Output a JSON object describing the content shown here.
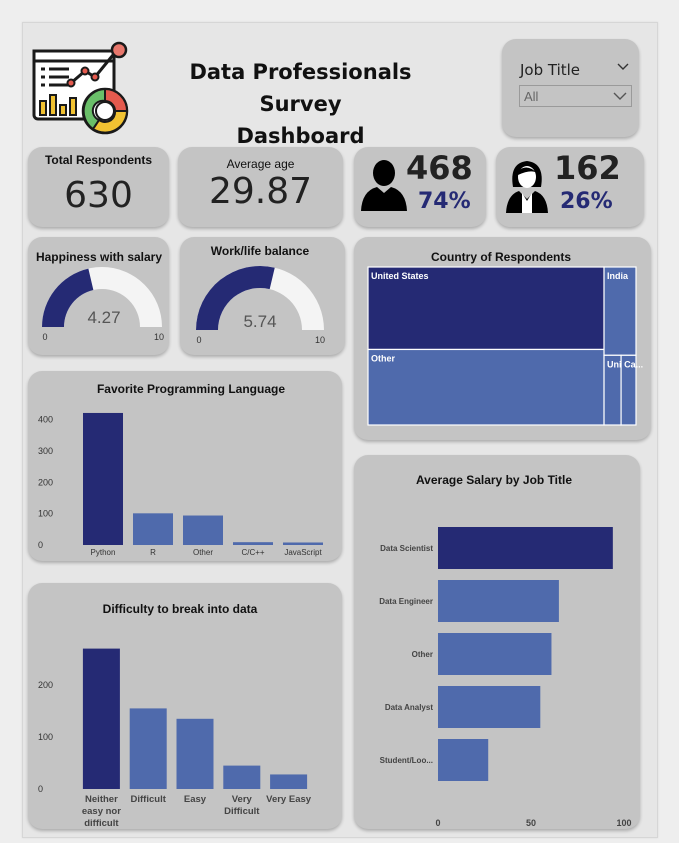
{
  "header": {
    "title_line1": "Data Professionals Survey",
    "title_line2": "Dashboard",
    "logo_icon": "analytics-dashboard-icon"
  },
  "filter": {
    "label": "Job Title",
    "selected": "All"
  },
  "kpis": {
    "total_respondents": {
      "label": "Total Respondents",
      "value": "630"
    },
    "average_age": {
      "label": "Average age",
      "value": "29.87"
    },
    "male": {
      "count": "468",
      "percent": "74%",
      "icon": "male-user-icon"
    },
    "female": {
      "count": "162",
      "percent": "26%",
      "icon": "female-user-icon"
    }
  },
  "gauges": {
    "salary": {
      "title": "Happiness with salary",
      "value_text": "4.27",
      "min_label": "0",
      "max_label": "10"
    },
    "worklife": {
      "title": "Work/life balance",
      "value_text": "5.74",
      "min_label": "0",
      "max_label": "10"
    }
  },
  "colors": {
    "dark": "#252a74",
    "mid": "#4f6aac",
    "card": "#c4c4c4"
  },
  "chart_data": [
    {
      "id": "gauge-salary",
      "type": "gauge",
      "title": "Happiness with salary",
      "value": 4.27,
      "min": 0,
      "max": 10
    },
    {
      "id": "gauge-worklife",
      "type": "gauge",
      "title": "Work/life balance",
      "value": 5.74,
      "min": 0,
      "max": 10
    },
    {
      "id": "treemap-country",
      "type": "treemap",
      "title": "Country of Respondents",
      "categories": [
        "United States",
        "Other",
        "India",
        "Uni...",
        "Ca..."
      ],
      "values": [
        262,
        240,
        38,
        16,
        14
      ]
    },
    {
      "id": "bar-language",
      "type": "bar",
      "title": "Favorite Programming Language",
      "categories": [
        "Python",
        "R",
        "Other",
        "C/C++",
        "JavaScript"
      ],
      "values": [
        421,
        101,
        94,
        9,
        8
      ],
      "ylim": [
        0,
        440
      ],
      "yticks": [
        "0",
        "100",
        "200",
        "300",
        "400"
      ]
    },
    {
      "id": "bar-difficulty",
      "type": "bar",
      "title": "Difficulty to break into data",
      "categories": [
        "Neither easy nor difficult",
        "Difficult",
        "Easy",
        "Very Difficult",
        "Very Easy"
      ],
      "label_lines": [
        [
          "Neither",
          "easy nor",
          "difficult"
        ],
        [
          "Difficult"
        ],
        [
          "Easy"
        ],
        [
          "Very",
          "Difficult"
        ],
        [
          "Very Easy"
        ]
      ],
      "values": [
        270,
        155,
        135,
        45,
        28
      ],
      "ylim": [
        0,
        275
      ],
      "yticks": [
        "0",
        "100",
        "200"
      ]
    },
    {
      "id": "barh-salary",
      "type": "bar",
      "orientation": "horizontal",
      "title": "Average Salary by Job Title",
      "categories": [
        "Data Scientist",
        "Data Engineer",
        "Other",
        "Data Analyst",
        "Student/Loo..."
      ],
      "values": [
        94,
        65,
        61,
        55,
        27
      ],
      "xlim": [
        0,
        100
      ],
      "xticks": [
        "0",
        "50",
        "100"
      ]
    }
  ]
}
